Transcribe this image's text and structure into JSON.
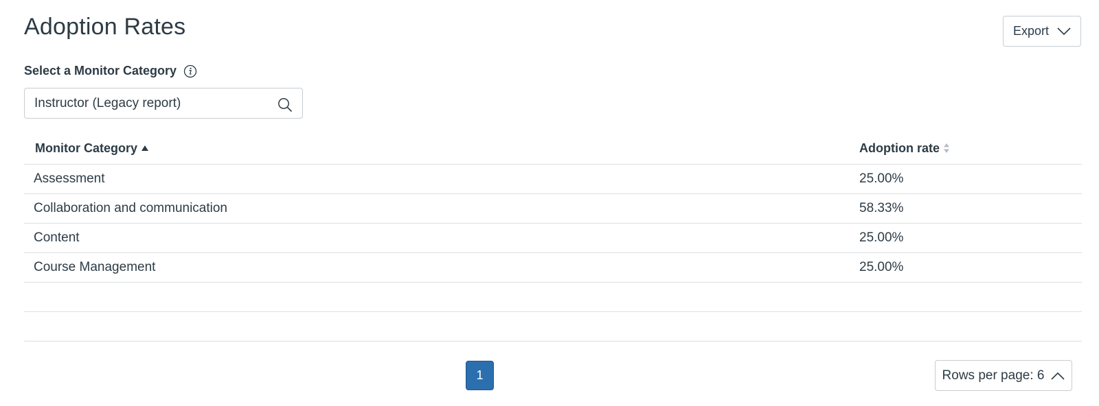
{
  "page": {
    "title": "Adoption Rates"
  },
  "export": {
    "label": "Export",
    "icon": "chevron-down-icon"
  },
  "filter": {
    "label": "Select a Monitor Category",
    "info_icon": "info-icon",
    "value": "Instructor (Legacy report)",
    "search_icon": "search-icon"
  },
  "table": {
    "columns": [
      {
        "label": "Monitor Category",
        "sort": "ascending"
      },
      {
        "label": "Adoption rate",
        "sort": "none"
      }
    ],
    "rows": [
      {
        "category": "Assessment",
        "rate": "25.00%"
      },
      {
        "category": "Collaboration and communication",
        "rate": "58.33%"
      },
      {
        "category": "Content",
        "rate": "25.00%"
      },
      {
        "category": "Course Management",
        "rate": "25.00%"
      }
    ]
  },
  "pagination": {
    "current_page": "1",
    "rows_per_page_label": "Rows per page: 6",
    "icon": "chevron-up-icon"
  },
  "colors": {
    "accent": "#2b6fae",
    "text": "#2d3b45",
    "border": "#c7cdd1"
  }
}
